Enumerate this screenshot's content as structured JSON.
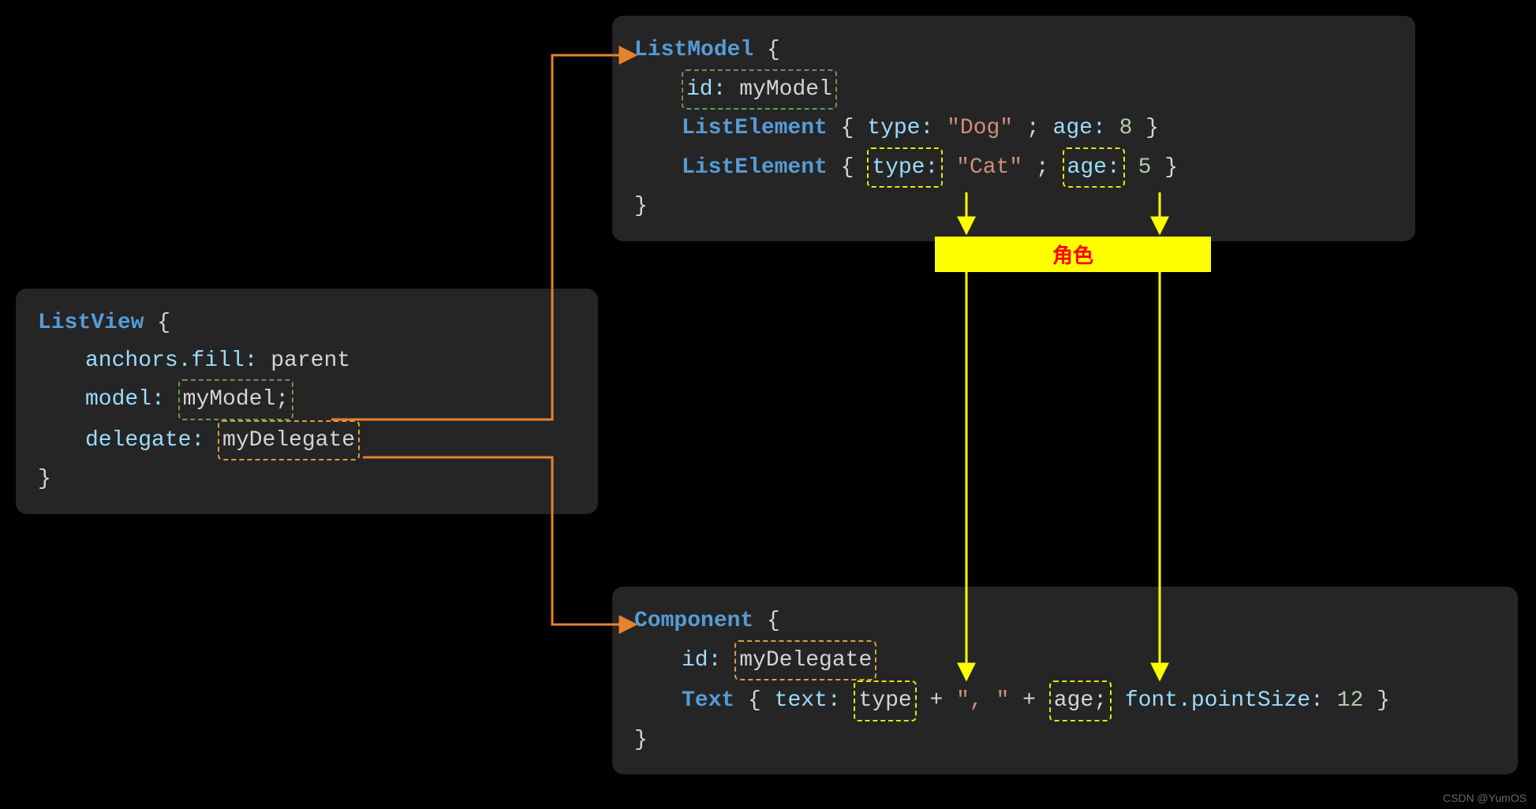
{
  "listview": {
    "title": "ListView",
    "anchors_prop": "anchors.fill:",
    "anchors_val": "parent",
    "model_prop": "model:",
    "model_val": "myModel;",
    "delegate_prop": "delegate:",
    "delegate_val": "myDelegate"
  },
  "listmodel": {
    "title": "ListModel",
    "id_prop": "id:",
    "id_val": "myModel",
    "elem": "ListElement",
    "type_prop": "type:",
    "age_prop": "age:",
    "rows": [
      {
        "type_val": "\"Dog\"",
        "age_val": "8"
      },
      {
        "type_val": "\"Cat\"",
        "age_val": "5"
      }
    ]
  },
  "component": {
    "title": "Component",
    "id_prop": "id:",
    "id_val": "myDelegate",
    "text_kw": "Text",
    "text_prop": "text:",
    "v1": "type",
    "plus1": "+",
    "sep": "\", \"",
    "plus2": "+",
    "v2": "age;",
    "font_prop": "font.pointSize:",
    "font_val": "12"
  },
  "role_label": "角色",
  "watermark": "CSDN @YumOS"
}
